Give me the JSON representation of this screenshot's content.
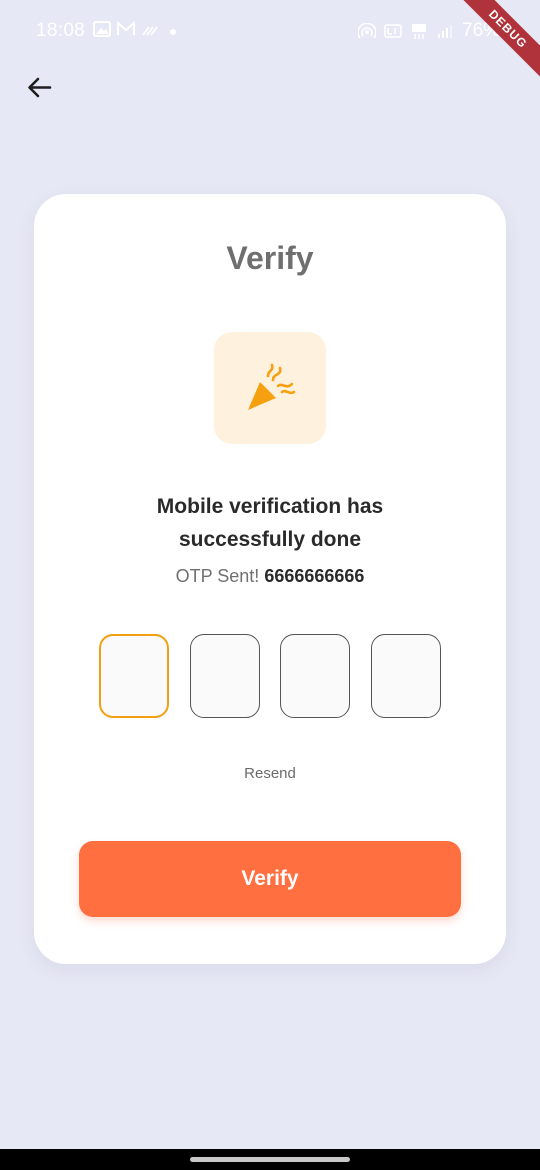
{
  "status_bar": {
    "time": "18:08",
    "battery": "76%"
  },
  "debug_label": "DEBUG",
  "card": {
    "title": "Verify",
    "message_line1": "Mobile verification has",
    "message_line2": "successfully done",
    "otp_prefix": "OTP Sent!",
    "otp_number": "6666666666",
    "otp_digits": [
      "",
      "",
      "",
      ""
    ],
    "resend_label": "Resend",
    "verify_label": "Verify"
  },
  "colors": {
    "background": "#e7e8f5",
    "accent": "#ff6f40",
    "otp_focus": "#f0a011",
    "icon_tile": "#fef1de",
    "icon": "#f6a010"
  },
  "icons": {
    "back": "arrow-left-icon",
    "celebration": "party-popper-icon"
  }
}
